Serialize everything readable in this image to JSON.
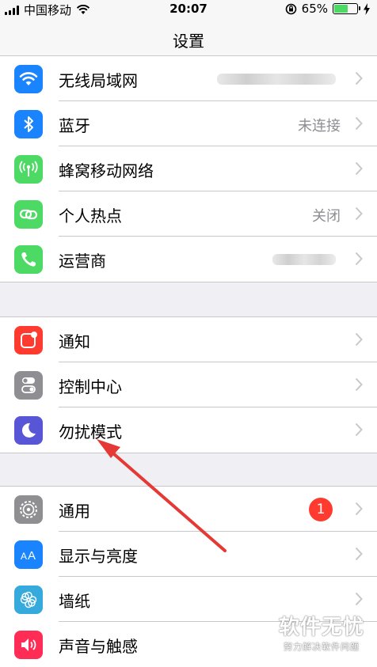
{
  "status_bar": {
    "carrier": "中国移动",
    "time": "20:07",
    "battery_percent": "65%",
    "battery_level": 0.65
  },
  "nav": {
    "title": "设置"
  },
  "groups": [
    {
      "rows": [
        {
          "label": "无线局域网",
          "value": "",
          "icon": "wifi-icon",
          "color": "#1a84ff"
        },
        {
          "label": "蓝牙",
          "value": "未连接",
          "icon": "bluetooth-icon",
          "color": "#1a84ff"
        },
        {
          "label": "蜂窝移动网络",
          "value": "",
          "icon": "cellular-icon",
          "color": "#4cd964"
        },
        {
          "label": "个人热点",
          "value": "关闭",
          "icon": "hotspot-icon",
          "color": "#4cd964"
        },
        {
          "label": "运营商",
          "value": "",
          "icon": "phone-icon",
          "color": "#4cd964"
        }
      ]
    },
    {
      "rows": [
        {
          "label": "通知",
          "value": "",
          "icon": "notification-icon",
          "color": "#ff3b30"
        },
        {
          "label": "控制中心",
          "value": "",
          "icon": "control-center-icon",
          "color": "#8e8e93"
        },
        {
          "label": "勿扰模式",
          "value": "",
          "icon": "moon-icon",
          "color": "#5856d6"
        }
      ]
    },
    {
      "rows": [
        {
          "label": "通用",
          "value": "",
          "badge": "1",
          "icon": "gear-icon",
          "color": "#8e8e93"
        },
        {
          "label": "显示与亮度",
          "value": "",
          "icon": "display-brightness-icon",
          "color": "#1a84ff"
        },
        {
          "label": "墙纸",
          "value": "",
          "icon": "wallpaper-icon",
          "color": "#36aadc"
        },
        {
          "label": "声音与触感",
          "value": "",
          "icon": "speaker-icon",
          "color": "#ff2d55"
        }
      ]
    }
  ],
  "watermark": {
    "main": "软件无忧",
    "sub": "努力解决软件问题"
  }
}
